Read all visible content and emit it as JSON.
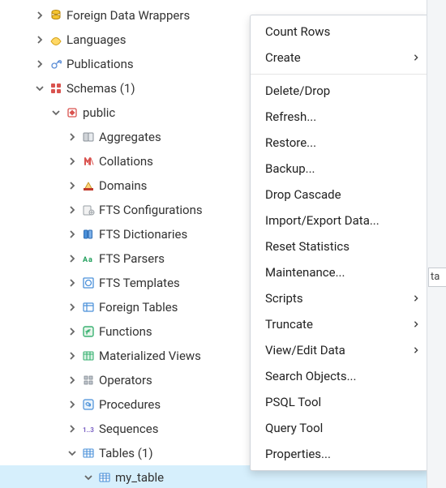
{
  "tree": {
    "items": [
      {
        "label": "Foreign Data Wrappers",
        "indent": 40,
        "expand": "right",
        "icon": "fdw",
        "selected": false
      },
      {
        "label": "Languages",
        "indent": 40,
        "expand": "right",
        "icon": "languages",
        "selected": false
      },
      {
        "label": "Publications",
        "indent": 40,
        "expand": "right",
        "icon": "publications",
        "selected": false
      },
      {
        "label": "Schemas (1)",
        "indent": 40,
        "expand": "down",
        "icon": "schemas",
        "selected": false
      },
      {
        "label": "public",
        "indent": 60,
        "expand": "down",
        "icon": "schema",
        "selected": false
      },
      {
        "label": "Aggregates",
        "indent": 80,
        "expand": "right",
        "icon": "aggregates",
        "selected": false
      },
      {
        "label": "Collations",
        "indent": 80,
        "expand": "right",
        "icon": "collations",
        "selected": false
      },
      {
        "label": "Domains",
        "indent": 80,
        "expand": "right",
        "icon": "domains",
        "selected": false
      },
      {
        "label": "FTS Configurations",
        "indent": 80,
        "expand": "right",
        "icon": "fts-config",
        "selected": false
      },
      {
        "label": "FTS Dictionaries",
        "indent": 80,
        "expand": "right",
        "icon": "fts-dict",
        "selected": false
      },
      {
        "label": "FTS Parsers",
        "indent": 80,
        "expand": "right",
        "icon": "fts-parsers",
        "selected": false
      },
      {
        "label": "FTS Templates",
        "indent": 80,
        "expand": "right",
        "icon": "fts-templates",
        "selected": false
      },
      {
        "label": "Foreign Tables",
        "indent": 80,
        "expand": "right",
        "icon": "foreign-tables",
        "selected": false
      },
      {
        "label": "Functions",
        "indent": 80,
        "expand": "right",
        "icon": "functions",
        "selected": false
      },
      {
        "label": "Materialized Views",
        "indent": 80,
        "expand": "right",
        "icon": "matviews",
        "selected": false
      },
      {
        "label": "Operators",
        "indent": 80,
        "expand": "right",
        "icon": "operators",
        "selected": false
      },
      {
        "label": "Procedures",
        "indent": 80,
        "expand": "right",
        "icon": "procedures",
        "selected": false
      },
      {
        "label": "Sequences",
        "indent": 80,
        "expand": "right",
        "icon": "sequences",
        "selected": false
      },
      {
        "label": "Tables (1)",
        "indent": 80,
        "expand": "down",
        "icon": "tables",
        "selected": false
      },
      {
        "label": "my_table",
        "indent": 100,
        "expand": "down",
        "icon": "table",
        "selected": true
      }
    ]
  },
  "context_menu": {
    "items": [
      {
        "label": "Count Rows",
        "submenu": false
      },
      {
        "label": "Create",
        "submenu": true
      },
      {
        "sep": true
      },
      {
        "label": "Delete/Drop",
        "submenu": false
      },
      {
        "label": "Refresh...",
        "submenu": false
      },
      {
        "label": "Restore...",
        "submenu": false
      },
      {
        "label": "Backup...",
        "submenu": false
      },
      {
        "label": "Drop Cascade",
        "submenu": false
      },
      {
        "label": "Import/Export Data...",
        "submenu": false
      },
      {
        "label": "Reset Statistics",
        "submenu": false
      },
      {
        "label": "Maintenance...",
        "submenu": false
      },
      {
        "label": "Scripts",
        "submenu": true
      },
      {
        "label": "Truncate",
        "submenu": true
      },
      {
        "label": "View/Edit Data",
        "submenu": true
      },
      {
        "label": "Search Objects...",
        "submenu": false
      },
      {
        "label": "PSQL Tool",
        "submenu": false
      },
      {
        "label": "Query Tool",
        "submenu": false
      },
      {
        "label": "Properties...",
        "submenu": false
      }
    ]
  },
  "right_fragment": "ta"
}
